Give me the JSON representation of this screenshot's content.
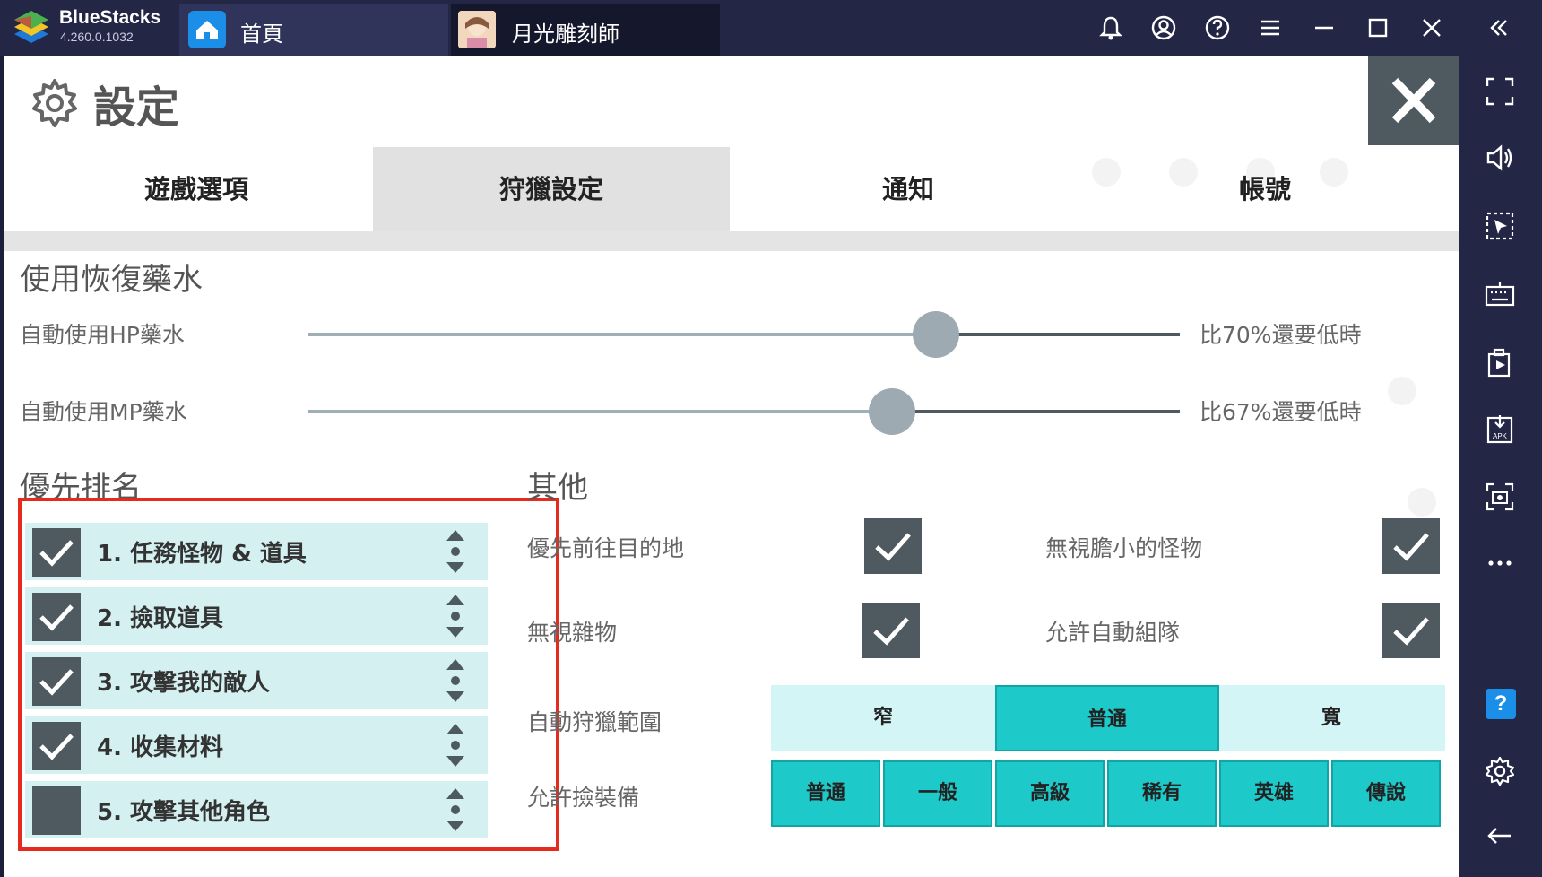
{
  "titlebar": {
    "brand": "BlueStacks",
    "version": "4.260.0.1032",
    "tabs": [
      {
        "label": "首頁",
        "icon": "home-icon"
      },
      {
        "label": "月光雕刻師",
        "icon": "game-avatar-icon"
      }
    ],
    "icons": [
      "bell-icon",
      "account-icon",
      "help-icon",
      "menu-icon",
      "minimize-icon",
      "maximize-icon",
      "close-icon",
      "collapse-sidebar-icon"
    ]
  },
  "sidebar": {
    "icons": [
      "fullscreen-icon",
      "volume-icon",
      "pointer-select-icon",
      "keyboard-icon",
      "multi-instance-icon",
      "install-apk-icon",
      "screenshot-icon",
      "more-icon",
      "help-badge-icon",
      "settings-icon",
      "back-icon"
    ],
    "help_label": "?",
    "apk_label": "APK"
  },
  "settings": {
    "title": "設定",
    "tabs": [
      "遊戲選項",
      "狩獵設定",
      "通知",
      "帳號"
    ],
    "active_tab": "狩獵設定",
    "potions": {
      "title": "使用恢復藥水",
      "hp_label": "自動使用HP藥水",
      "hp_value": "比70%還要低時",
      "hp_level": 0.72,
      "mp_label": "自動使用MP藥水",
      "mp_value": "比67%還要低時",
      "mp_level": 0.67
    },
    "priority": {
      "title": "優先排名",
      "items": [
        {
          "label": "1.  任務怪物 & 道具",
          "checked": true
        },
        {
          "label": "2.  撿取道具",
          "checked": true
        },
        {
          "label": "3.  攻擊我的敵人",
          "checked": true
        },
        {
          "label": "4.  收集材料",
          "checked": true
        },
        {
          "label": "5.  攻擊其他角色",
          "checked": false
        }
      ]
    },
    "other": {
      "title": "其他",
      "options": [
        {
          "label": "優先前往目的地",
          "checked": true
        },
        {
          "label": "無視膽小的怪物",
          "checked": true
        },
        {
          "label": "無視雜物",
          "checked": true
        },
        {
          "label": "允許自動組隊",
          "checked": true
        }
      ],
      "range_label": "自動狩獵範圍",
      "range_options": [
        "窄",
        "普通",
        "寬"
      ],
      "range_selected": "普通",
      "equip_label": "允許撿裝備",
      "equip_grades": [
        "普通",
        "一般",
        "高級",
        "稀有",
        "英雄",
        "傳說"
      ]
    }
  },
  "colors": {
    "titlebar_bg": "#232645",
    "accent_teal": "#1ec9c9",
    "item_bg": "#d4f0f0",
    "checkbox": "#4e5a60",
    "highlight_red": "#e52a1e"
  }
}
